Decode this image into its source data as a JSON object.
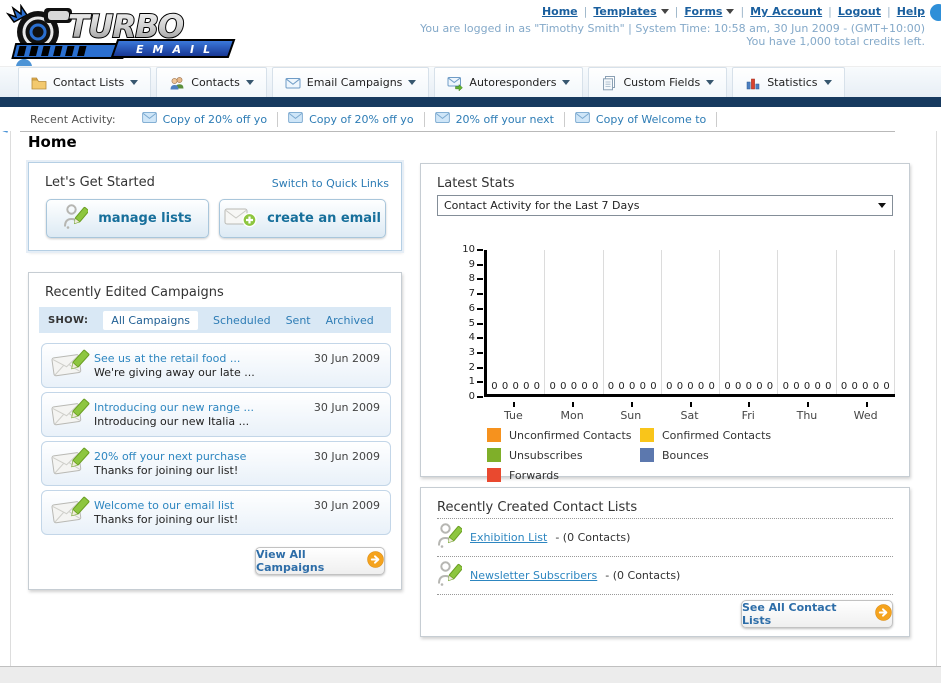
{
  "header": {
    "logo": {
      "title": "TURBO",
      "subtitle": "EMAIL"
    },
    "nav_links": [
      {
        "label": "Home",
        "dropdown": false
      },
      {
        "label": "Templates",
        "dropdown": true
      },
      {
        "label": "Forms",
        "dropdown": true
      },
      {
        "label": "My Account",
        "dropdown": false
      },
      {
        "label": "Logout",
        "dropdown": false
      },
      {
        "label": "Help",
        "dropdown": false
      }
    ],
    "login_line": "You are logged in as \"Timothy Smith\" | System Time: 10:58 am, 30 Jun 2009 - (GMT+10:00)",
    "credits_line": "You have 1,000 total credits left."
  },
  "menu": {
    "tabs": [
      {
        "label": "Contact Lists",
        "icon": "contact-lists-icon"
      },
      {
        "label": "Contacts",
        "icon": "contacts-icon"
      },
      {
        "label": "Email Campaigns",
        "icon": "email-campaigns-icon"
      },
      {
        "label": "Autoresponders",
        "icon": "autoresponders-icon"
      },
      {
        "label": "Custom Fields",
        "icon": "custom-fields-icon"
      },
      {
        "label": "Statistics",
        "icon": "statistics-icon"
      }
    ]
  },
  "recent_activity": {
    "label": "Recent Activity:",
    "items": [
      "Copy of 20% off yo",
      "Copy of 20% off yo",
      "20% off your next",
      "Copy of Welcome to"
    ]
  },
  "page": {
    "title": "Home"
  },
  "get_started": {
    "title": "Let's Get Started",
    "switch_link": "Switch to Quick Links",
    "buttons": [
      {
        "label": "manage lists"
      },
      {
        "label": "create an email"
      }
    ]
  },
  "campaigns": {
    "title": "Recently Edited Campaigns",
    "show_label": "SHOW:",
    "tabs": [
      {
        "label": "All Campaigns",
        "active": true
      },
      {
        "label": "Scheduled",
        "active": false
      },
      {
        "label": "Sent",
        "active": false
      },
      {
        "label": "Archived",
        "active": false
      }
    ],
    "items": [
      {
        "title": "See us at the retail food ...",
        "subtitle": "We're giving away our late ...",
        "date": "30 Jun 2009"
      },
      {
        "title": "Introducing our new range ...",
        "subtitle": "Introducing our new Italia ...",
        "date": "30 Jun 2009"
      },
      {
        "title": "20% off your next purchase",
        "subtitle": "Thanks for joining our list!",
        "date": "30 Jun 2009"
      },
      {
        "title": "Welcome to our email list",
        "subtitle": "Thanks for joining our list!",
        "date": "30 Jun 2009"
      }
    ],
    "view_all_label": "View All Campaigns"
  },
  "stats": {
    "title": "Latest Stats",
    "selected_option": "Contact Activity for the Last 7 Days"
  },
  "chart_data": {
    "type": "bar",
    "title": "Contact Activity for the Last 7 Days",
    "categories": [
      "Tue",
      "Mon",
      "Sun",
      "Sat",
      "Fri",
      "Thu",
      "Wed"
    ],
    "series": [
      {
        "name": "Unconfirmed Contacts",
        "color": "#F6921E",
        "values": [
          0,
          0,
          0,
          0,
          0,
          0,
          0
        ]
      },
      {
        "name": "Confirmed Contacts",
        "color": "#F9C51A",
        "values": [
          0,
          0,
          0,
          0,
          0,
          0,
          0
        ]
      },
      {
        "name": "Unsubscribes",
        "color": "#7FAF29",
        "values": [
          0,
          0,
          0,
          0,
          0,
          0,
          0
        ]
      },
      {
        "name": "Bounces",
        "color": "#5C78AE",
        "values": [
          0,
          0,
          0,
          0,
          0,
          0,
          0
        ]
      },
      {
        "name": "Forwards",
        "color": "#E9492F",
        "values": [
          0,
          0,
          0,
          0,
          0,
          0,
          0
        ]
      }
    ],
    "ylim": [
      0,
      10
    ],
    "ytick_step": 1,
    "grid": true,
    "legend_position": "bottom"
  },
  "contact_lists": {
    "title": "Recently Created Contact Lists",
    "items": [
      {
        "name": "Exhibition List",
        "count": "- (0 Contacts)"
      },
      {
        "name": "Newsletter Subscribers",
        "count": "- (0 Contacts)"
      }
    ],
    "see_all_label": "See All Contact Lists"
  }
}
